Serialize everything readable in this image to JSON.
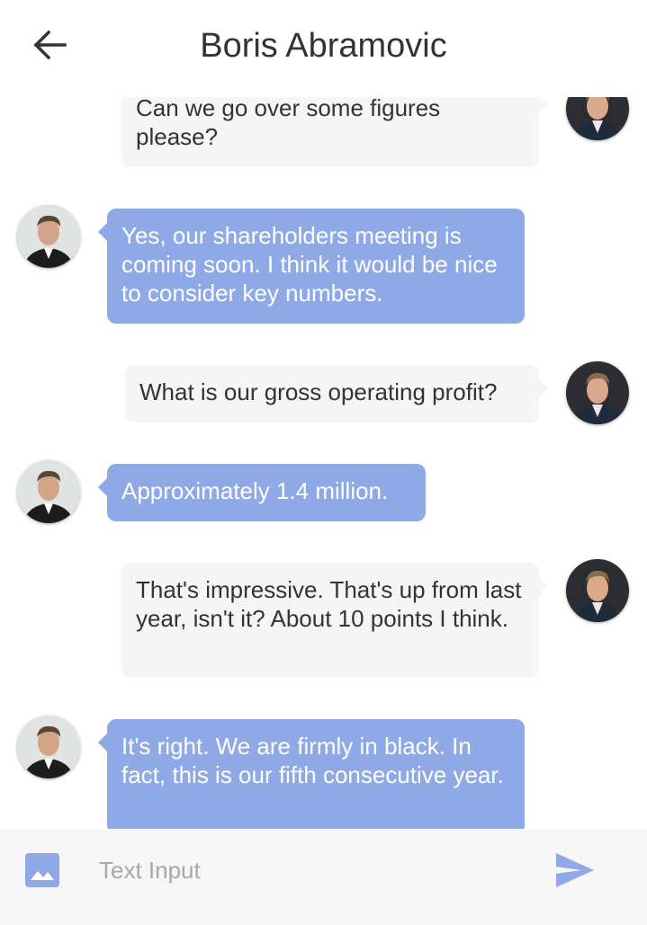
{
  "header": {
    "title": "Boris Abramovic"
  },
  "messages": [
    {
      "from": "me",
      "text": "Can we go over some figures please?"
    },
    {
      "from": "them",
      "text": "Yes, our shareholders meeting is coming soon. I think it would be nice to consider key numbers."
    },
    {
      "from": "me",
      "text": "What is our gross operating profit?"
    },
    {
      "from": "them",
      "text": "Approximately 1.4 million."
    },
    {
      "from": "me",
      "text": "That's impressive. That's up from last year, isn't it? About 10 points I think."
    },
    {
      "from": "them",
      "text": "It's right. We are firmly in black. In fact, this is our fifth consecutive year."
    }
  ],
  "composer": {
    "placeholder": "Text Input"
  },
  "colors": {
    "accent": "#8ea9e6",
    "my_bubble": "#f5f5f5",
    "icon_blue": "#8ea9e6"
  },
  "icons": {
    "back": "arrow-back-icon",
    "image": "image-icon",
    "send": "send-icon"
  }
}
